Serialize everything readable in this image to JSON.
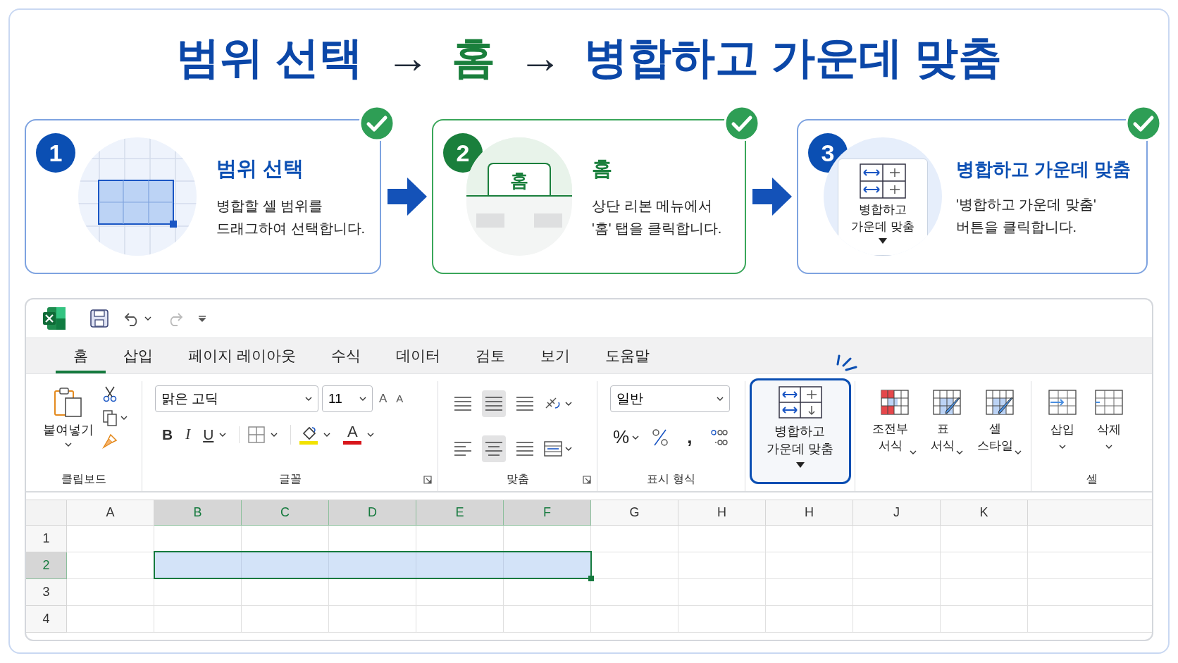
{
  "headline": [
    {
      "kind": "text",
      "text": "범위 선택"
    },
    {
      "kind": "arrow",
      "text": "→"
    },
    {
      "kind": "accent",
      "text": "홈"
    },
    {
      "kind": "arrow",
      "text": "→"
    },
    {
      "kind": "text",
      "text": "병합하고 가운데 맞춤"
    }
  ],
  "steps": [
    {
      "kind": "range",
      "number": "1",
      "title": "범위 선택",
      "description": "병합할 셀 범위를\n드래그하여 선택합니다.",
      "color": "#0b4fb3",
      "completed": true
    },
    {
      "kind": "tab",
      "number": "2",
      "title": "홈",
      "description": "상단 리본 메뉴에서\n'홈' 탭을 클릭합니다.",
      "color": "#1a7f3c",
      "completed": true,
      "illustration_label": "홈"
    },
    {
      "kind": "button",
      "number": "3",
      "title": "병합하고 가운데 맞춤",
      "description": "'병합하고 가운데 맞춤'\n버튼을 클릭합니다.",
      "color": "#0b4fb3",
      "completed": true,
      "illustration_label": "병합하고\n가운데 맞춤"
    }
  ],
  "excel": {
    "tabs": [
      {
        "label": "홈",
        "selected": true
      },
      {
        "label": "삽입",
        "selected": false
      },
      {
        "label": "페이지 레이아웃",
        "selected": false
      },
      {
        "label": "수식",
        "selected": false
      },
      {
        "label": "데이터",
        "selected": false
      },
      {
        "label": "검토",
        "selected": false
      },
      {
        "label": "보기",
        "selected": false
      },
      {
        "label": "도움말",
        "selected": false
      }
    ],
    "ribbon": {
      "clipboard": {
        "label": "클립보드",
        "paste": "붙여넣기"
      },
      "font": {
        "label": "글꼴",
        "font_name": "맑은 고딕",
        "font_size": "11",
        "grow": "A",
        "shrink": "A",
        "bold": "B",
        "italic": "I",
        "underline": "U",
        "font_color": "A"
      },
      "alignment": {
        "label": "맞춤"
      },
      "number": {
        "label": "표시 형식",
        "format": "일반",
        "percent": "%",
        "comma": ","
      },
      "merge_button": {
        "label": "병합하고\n가운데 맞춤",
        "highlighted": true
      },
      "styles": [
        "조전부\n서식",
        "표\n서식",
        "셀\n스타일"
      ],
      "cells": {
        "label": "셀",
        "buttons": [
          "삽입",
          "삭제"
        ]
      }
    },
    "sheet": {
      "columns": [
        {
          "label": "A",
          "selected": false
        },
        {
          "label": "B",
          "selected": true
        },
        {
          "label": "C",
          "selected": true
        },
        {
          "label": "D",
          "selected": true
        },
        {
          "label": "E",
          "selected": true
        },
        {
          "label": "F",
          "selected": true
        },
        {
          "label": "G",
          "selected": false
        },
        {
          "label": "H",
          "selected": false
        },
        {
          "label": "H",
          "selected": false
        },
        {
          "label": "J",
          "selected": false
        },
        {
          "label": "K",
          "selected": false
        }
      ],
      "rows": [
        {
          "label": "1",
          "selected": false
        },
        {
          "label": "2",
          "selected": true
        },
        {
          "label": "3",
          "selected": false
        },
        {
          "label": "4",
          "selected": false
        }
      ]
    }
  }
}
